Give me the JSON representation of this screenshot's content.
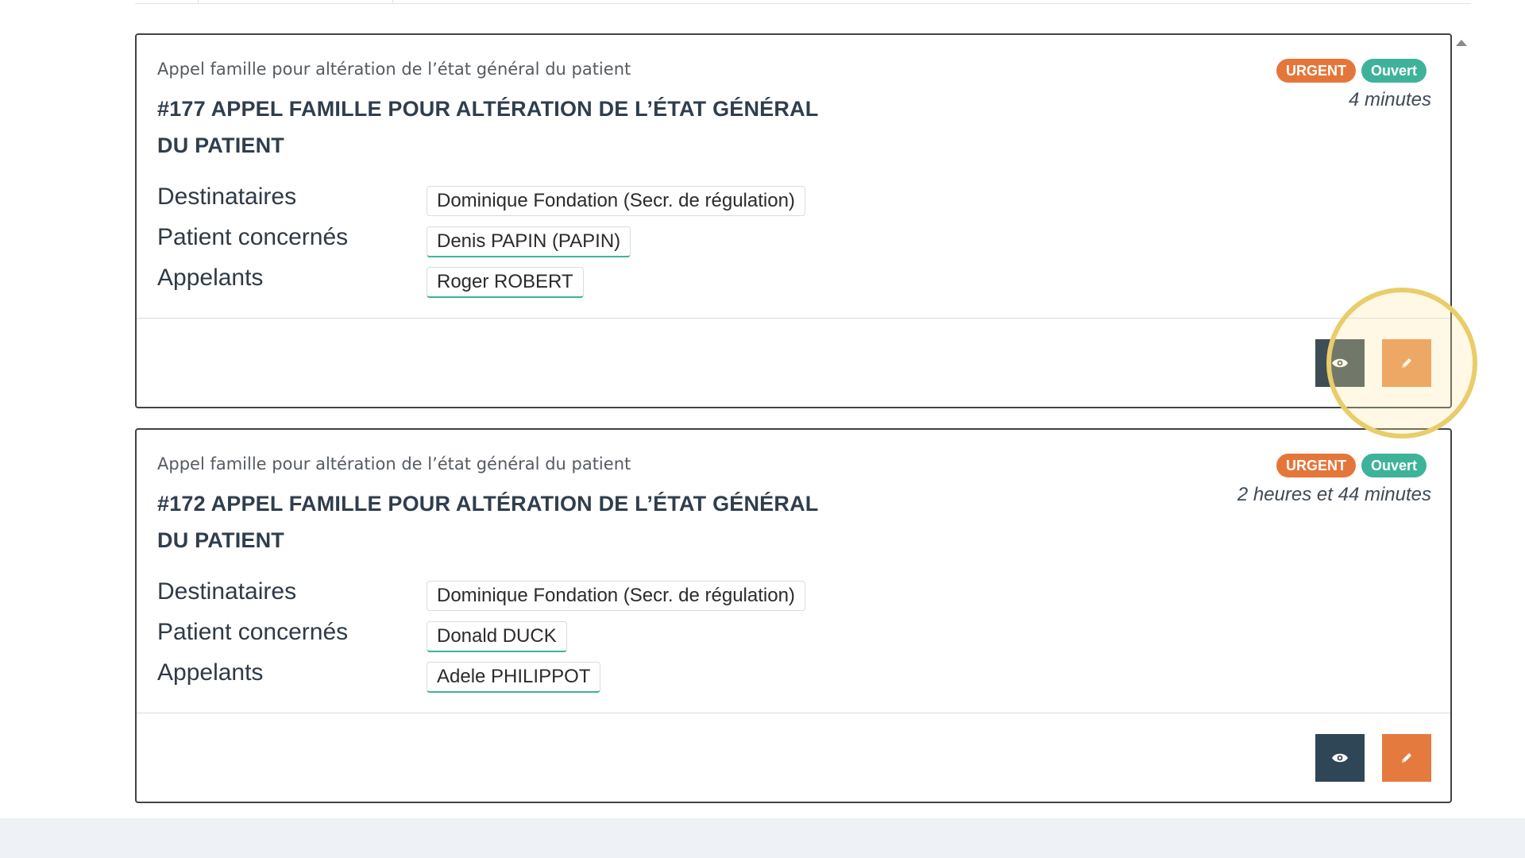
{
  "cards": [
    {
      "subtitle": "Appel famille pour altération de l’état général du patient",
      "title": "#177 APPEL FAMILLE POUR ALTÉRATION DE L’ÉTAT GÉNÉRAL DU PATIENT",
      "badges": {
        "priority": "URGENT",
        "status": "Ouvert"
      },
      "elapsed": "4 minutes",
      "fields": {
        "recipients_label": "Destinataires",
        "recipients_value": "Dominique Fondation (Secr. de régulation)",
        "patients_label": "Patient concernés",
        "patients_value": "Denis PAPIN (PAPIN)",
        "callers_label": "Appelants",
        "callers_value": "Roger ROBERT"
      }
    },
    {
      "subtitle": "Appel famille pour altération de l’état général du patient",
      "title": "#172 APPEL FAMILLE POUR ALTÉRATION DE L’ÉTAT GÉNÉRAL DU PATIENT",
      "badges": {
        "priority": "URGENT",
        "status": "Ouvert"
      },
      "elapsed": "2 heures et 44 minutes",
      "fields": {
        "recipients_label": "Destinataires",
        "recipients_value": "Dominique Fondation (Secr. de régulation)",
        "patients_label": "Patient concernés",
        "patients_value": "Donald DUCK",
        "callers_label": "Appelants",
        "callers_value": "Adele PHILIPPOT"
      }
    }
  ],
  "icons": {
    "view": "eye-icon",
    "edit": "pencil-icon",
    "scroll": "caret-up-icon"
  },
  "colors": {
    "urgent": "#e5763a",
    "open": "#3eb39a",
    "view_button": "#2f4656",
    "edit_button": "#e57a3e",
    "highlight": "#e9cd6a"
  }
}
